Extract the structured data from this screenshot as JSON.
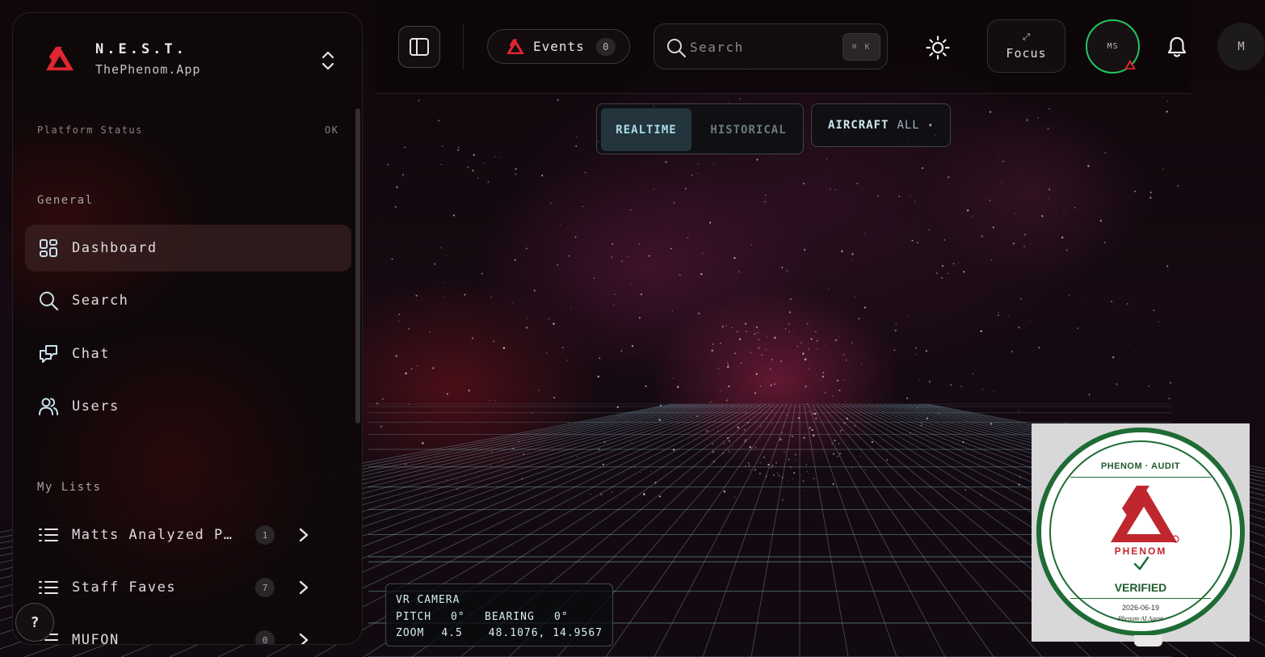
{
  "brand": {
    "name": "N.E.S.T.",
    "subtitle": "ThePhenom.App",
    "accent": "#e0262f"
  },
  "topbar": {
    "events_label": "Events",
    "events_count": "0",
    "search_placeholder": "Search",
    "search_shortcut": "⌘ K",
    "focus_icon": "⤢",
    "focus_label": "Focus",
    "user_initials": "MS",
    "account_initial": "M",
    "online_color": "#22c55e"
  },
  "map_controls": {
    "mode_active": "REALTIME",
    "mode_inactive": "HISTORICAL",
    "filter_key": "AIRCRAFT",
    "filter_value": "ALL",
    "filter_caret": "▾"
  },
  "camera": {
    "title": "VR CAMERA",
    "pitch_label": "PITCH",
    "pitch_value": "0°",
    "bearing_label": "BEARING",
    "bearing_value": "0°",
    "zoom_label": "ZOOM",
    "zoom_value": "4.5",
    "coords": "48.1076, 14.9567"
  },
  "sidebar": {
    "platform_status_label": "Platform Status",
    "platform_status_value": "OK",
    "general_title": "General",
    "nav": [
      {
        "label": "Dashboard",
        "icon": "dashboard-icon",
        "active": true
      },
      {
        "label": "Search",
        "icon": "search-icon"
      },
      {
        "label": "Chat",
        "icon": "chat-icon"
      },
      {
        "label": "Users",
        "icon": "users-icon"
      }
    ],
    "lists_title": "My Lists",
    "lists": [
      {
        "label": "Matts Analyzed P…",
        "count": "1"
      },
      {
        "label": "Staff Faves",
        "count": "7"
      },
      {
        "label": "MUFON",
        "count": "0"
      }
    ],
    "help_label": "?"
  },
  "seal": {
    "header": "PHENOM · AUDIT",
    "brand": "PHENOM",
    "status": "VERIFIED",
    "date": "2026-06-19",
    "agent": "Phenom AI Agent",
    "ring_color": "#1f6b35"
  }
}
